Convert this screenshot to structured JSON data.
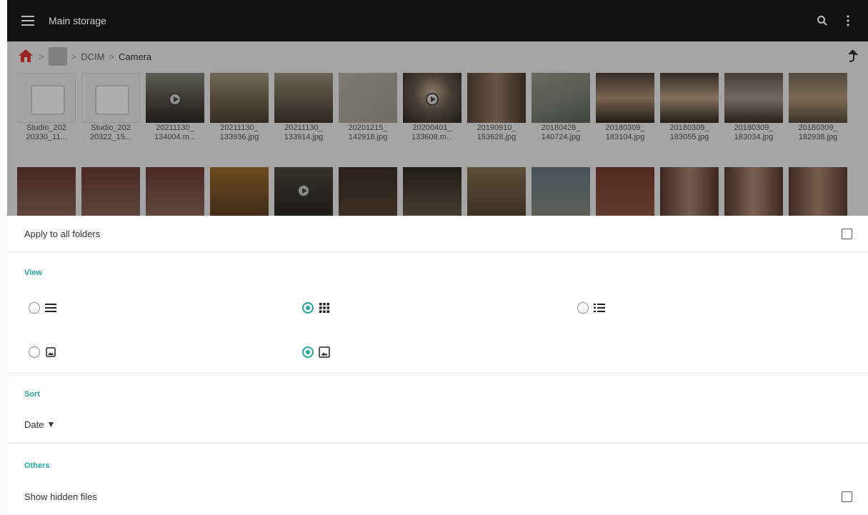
{
  "appbar": {
    "title": "Main storage",
    "menu_icon": "hamburger-menu-icon",
    "search_icon": "search-icon",
    "more_icon": "more-vertical-icon",
    "background": "#111111"
  },
  "breadcrumb": {
    "home_icon": "home-icon",
    "items": [
      ">",
      "> DCIM",
      "> Camera"
    ],
    "dcim": "DCIM",
    "camera": "Camera",
    "up_icon": "up-arrow-icon"
  },
  "files_row1": [
    {
      "name": "Studio_202\n20330_11..."
    },
    {
      "name": "Studio_202\n20322_15..."
    },
    {
      "name": "20211130_\n134004.m..."
    },
    {
      "name": "20211130_\n133936.jpg"
    },
    {
      "name": "20211130_\n133914.jpg"
    },
    {
      "name": "20201215_\n142918.jpg"
    },
    {
      "name": "20200401_\n133608.m..."
    },
    {
      "name": "20190910_\n153628.jpg"
    },
    {
      "name": "20180426_\n140724.jpg"
    },
    {
      "name": "20180309_\n183104.jpg"
    },
    {
      "name": "20180309_\n183055.jpg"
    },
    {
      "name": "20180309_\n183034.jpg"
    },
    {
      "name": "20180309_\n182938.jpg"
    }
  ],
  "sheet": {
    "apply_all_label": "Apply to all folders",
    "view_label": "View",
    "sort_label": "Sort",
    "sort_value": "Date",
    "sort_arrow": "▼",
    "others_label": "Others",
    "show_hidden_label": "Show hidden files",
    "view_options": [
      {
        "icon": "list-view-icon",
        "selected": false
      },
      {
        "icon": "grid-view-icon",
        "selected": true
      },
      {
        "icon": "detailed-list-view-icon",
        "selected": false
      },
      {
        "icon": "thumbnail-icon",
        "selected": false
      },
      {
        "icon": "thumbnail-icon",
        "selected": true
      }
    ],
    "accent": "#26a69a"
  }
}
